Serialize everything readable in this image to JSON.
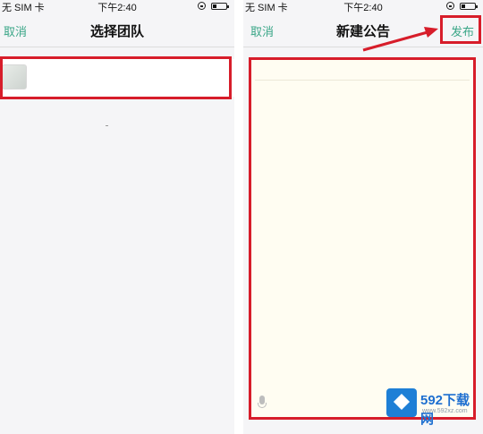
{
  "left_screen": {
    "status": {
      "carrier": "无 SIM 卡",
      "time": "下午2:40",
      "battery_level": 0.3
    },
    "nav": {
      "left": "取消",
      "title": "选择团队"
    }
  },
  "right_screen": {
    "status": {
      "carrier": "无 SIM 卡",
      "time": "下午2:40",
      "battery_level": 0.3
    },
    "nav": {
      "left": "取消",
      "title": "新建公告",
      "right": "发布"
    }
  },
  "watermark": {
    "name": "592下载网",
    "url": "www.592xz.com"
  },
  "colors": {
    "accent": "#3aa687",
    "highlight": "#d71d2a"
  }
}
